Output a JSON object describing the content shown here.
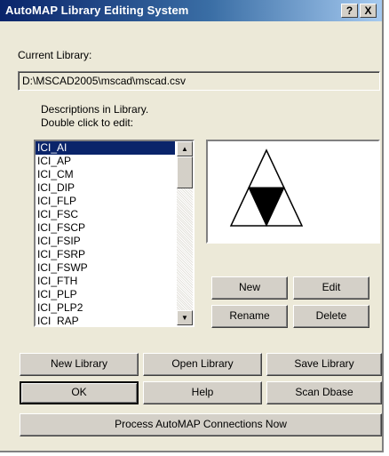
{
  "window": {
    "title": "AutoMAP Library Editing System",
    "help_button": "?",
    "close_button": "X"
  },
  "current_library": {
    "label": "Current Library:",
    "path": "D:\\MSCAD2005\\mscad\\mscad.csv"
  },
  "descriptions": {
    "label_line1": "Descriptions in Library.",
    "label_line2": "Double click to edit:"
  },
  "list": {
    "items": [
      "ICI_AI",
      "ICI_AP",
      "ICI_CM",
      "ICI_DIP",
      "ICI_FLP",
      "ICI_FSC",
      "ICI_FSCP",
      "ICI_FSIP",
      "ICI_FSRP",
      "ICI_FSWP",
      "ICI_FTH",
      "ICI_PLP",
      "ICI_PLP2",
      "ICI_RAP"
    ],
    "selected": "ICI_AI"
  },
  "scrollbar": {
    "up_icon": "arrow-up-icon",
    "down_icon": "arrow-down-icon"
  },
  "preview": {
    "symbol": "triangle-symbol-with-filled-inverted-triangle"
  },
  "buttons": {
    "new": "New",
    "edit": "Edit",
    "rename": "Rename",
    "delete": "Delete",
    "new_library": "New Library",
    "open_library": "Open Library",
    "save_library": "Save Library",
    "ok": "OK",
    "help": "Help",
    "scan_dbase": "Scan Dbase",
    "process": "Process AutoMAP Connections Now"
  },
  "colors": {
    "title_bar": "#0a246a",
    "selection": "#0a246a",
    "dialog_bg": "#ece9d8"
  }
}
